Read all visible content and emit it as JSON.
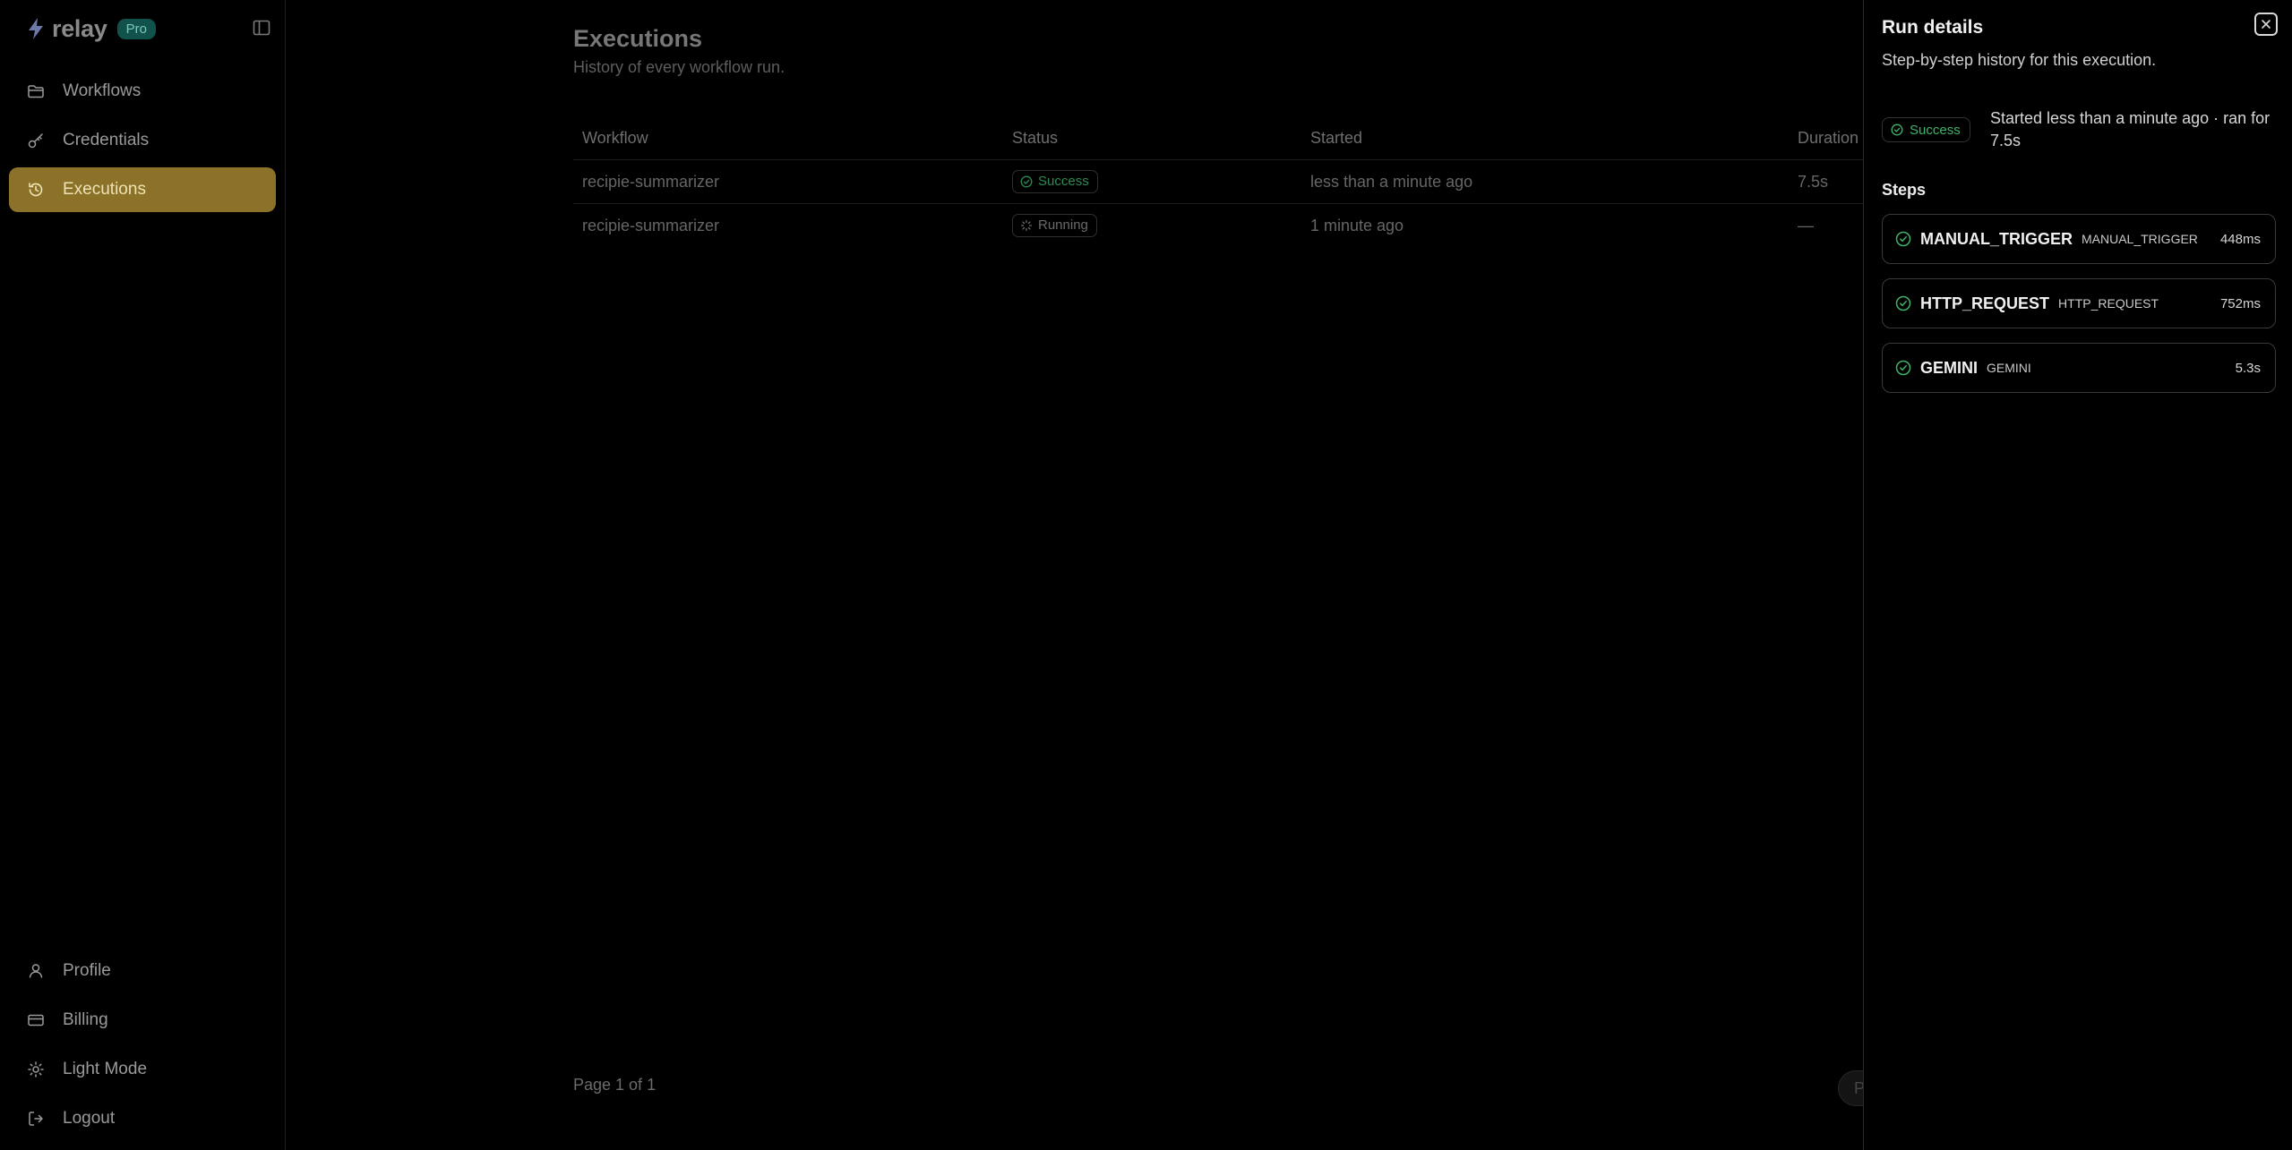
{
  "app": {
    "name": "relay",
    "plan_badge": "Pro"
  },
  "colors": {
    "accent": "#8c7228",
    "success": "#3fb36b",
    "pro_badge": "#11524c"
  },
  "sidebar": {
    "nav": [
      {
        "label": "Workflows",
        "icon": "folder-icon",
        "active": false
      },
      {
        "label": "Credentials",
        "icon": "key-icon",
        "active": false
      },
      {
        "label": "Executions",
        "icon": "history-icon",
        "active": true
      }
    ],
    "footer": [
      {
        "label": "Profile",
        "icon": "user-icon"
      },
      {
        "label": "Billing",
        "icon": "credit-card-icon"
      },
      {
        "label": "Light Mode",
        "icon": "sun-icon"
      },
      {
        "label": "Logout",
        "icon": "logout-icon"
      }
    ]
  },
  "main": {
    "title": "Executions",
    "subtitle": "History of every workflow run.",
    "table": {
      "columns": [
        "Workflow",
        "Status",
        "Started",
        "Duration"
      ],
      "rows": [
        {
          "workflow": "recipie-summarizer",
          "status": "Success",
          "started": "less than a minute ago",
          "duration": "7.5s"
        },
        {
          "workflow": "recipie-summarizer",
          "status": "Running",
          "started": "1 minute ago",
          "duration": "—"
        }
      ]
    },
    "pagination": {
      "text": "Page 1 of 1",
      "button_label": "P"
    }
  },
  "drawer": {
    "title": "Run details",
    "subtitle": "Step-by-step history for this execution.",
    "status": "Success",
    "summary": "Started less than a minute ago · ran for 7.5s",
    "steps_heading": "Steps",
    "steps": [
      {
        "name": "MANUAL_TRIGGER",
        "type": "MANUAL_TRIGGER",
        "duration": "448ms"
      },
      {
        "name": "HTTP_REQUEST",
        "type": "HTTP_REQUEST",
        "duration": "752ms"
      },
      {
        "name": "GEMINI",
        "type": "GEMINI",
        "duration": "5.3s"
      }
    ]
  }
}
